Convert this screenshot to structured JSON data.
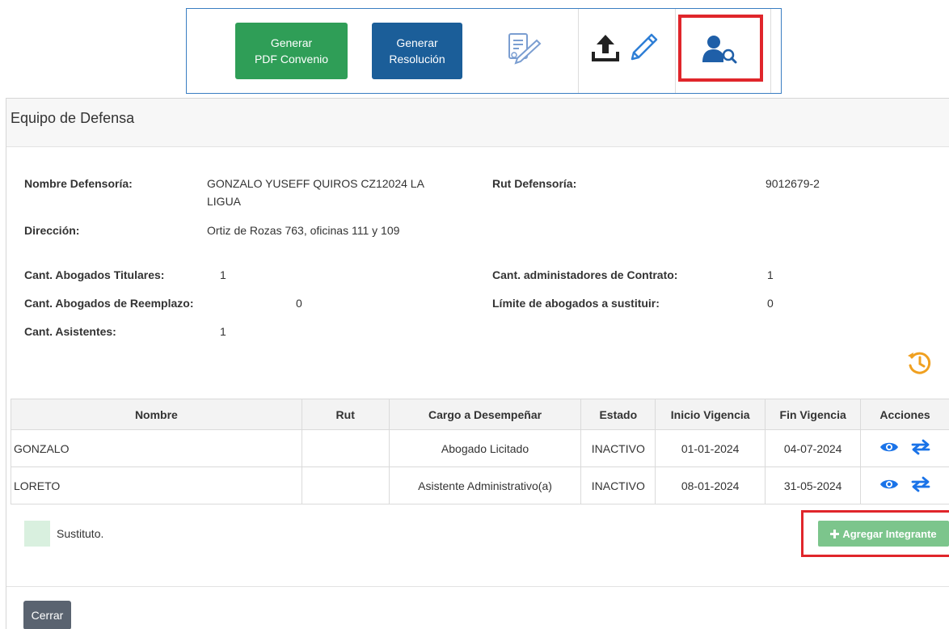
{
  "toolbar": {
    "pdf_button": {
      "line1": "Generar",
      "line2": "PDF Convenio"
    },
    "resolution_button": {
      "line1": "Generar",
      "line2": "Resolución"
    },
    "icons": [
      "edit-document-icon",
      "upload-icon",
      "pencil-icon",
      "user-search-icon"
    ]
  },
  "panel": {
    "title": "Equipo de Defensa",
    "fields": {
      "nombre_label": "Nombre Defensoría:",
      "nombre_value_line1": "GONZALO YUSEFF QUIROS CZ12024 LA",
      "nombre_value_line2": "LIGUA",
      "rut_label": "Rut Defensoría:",
      "rut_value": "9012679-2",
      "direccion_label": "Dirección:",
      "direccion_value": "Ortiz de Rozas 763, oficinas 111 y 109",
      "titulares_label": "Cant. Abogados Titulares:",
      "titulares_value": "1",
      "administradores_label": "Cant. administadores de Contrato:",
      "administradores_value": "1",
      "reemplazo_label": "Cant. Abogados de Reemplazo:",
      "reemplazo_value": "0",
      "limite_label": "Límite de abogados a sustituir:",
      "limite_value": "0",
      "asistentes_label": "Cant. Asistentes:",
      "asistentes_value": "1"
    }
  },
  "table": {
    "headers": [
      "Nombre",
      "Rut",
      "Cargo a Desempeñar",
      "Estado",
      "Inicio Vigencia",
      "Fin Vigencia",
      "Acciones"
    ],
    "rows": [
      {
        "nombre": "GONZALO",
        "rut": "",
        "cargo": "Abogado Licitado",
        "estado": "INACTIVO",
        "inicio": "01-01-2024",
        "fin": "04-07-2024"
      },
      {
        "nombre": "LORETO",
        "rut": "",
        "cargo": "Asistente Administrativo(a)",
        "estado": "INACTIVO",
        "inicio": "08-01-2024",
        "fin": "31-05-2024"
      }
    ]
  },
  "legend": {
    "label": "Sustituto."
  },
  "add_button": {
    "label": "Agregar Integrante"
  },
  "close_button": {
    "label": "Cerrar"
  },
  "colors": {
    "green_button": "#2f9e57",
    "blue_button": "#1b5e99",
    "highlight": "#e0262b",
    "action_icon": "#1a73e8",
    "history_icon": "#f0a020"
  }
}
